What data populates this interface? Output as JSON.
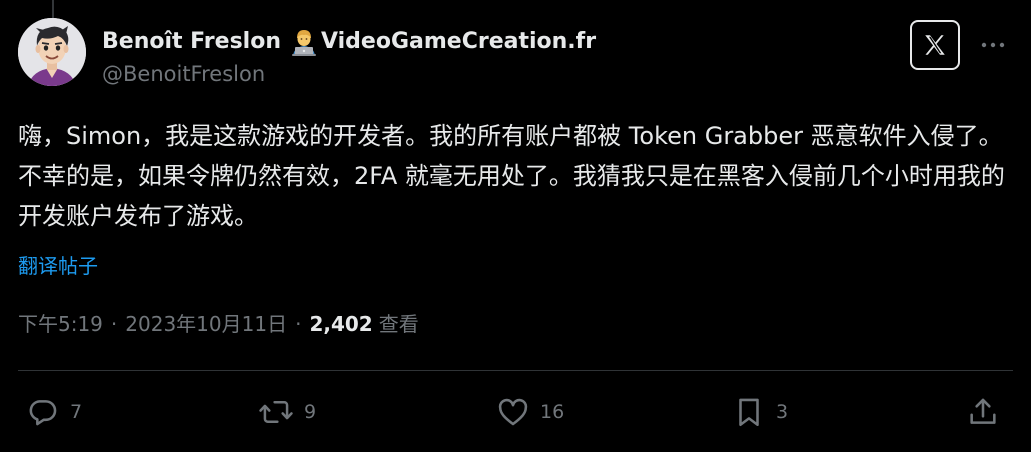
{
  "author": {
    "display_name": "Benoît Freslon",
    "name_suffix": "VideoGameCreation.fr",
    "handle": "@BenoitFreslon"
  },
  "tweet": {
    "text": "嗨，Simon，我是这款游戏的开发者。我的所有账户都被 Token Grabber 恶意软件入侵了。不幸的是，如果令牌仍然有效，2FA 就毫无用处了。我猜我只是在黑客入侵前几个小时用我的开发账户发布了游戏。",
    "translate_label": "翻译帖子"
  },
  "meta": {
    "time": "下午5:19",
    "separator": "·",
    "date": "2023年10月11日",
    "views_count": "2,402",
    "views_label": "查看"
  },
  "actions": {
    "replies": "7",
    "reposts": "9",
    "likes": "16",
    "bookmarks": "3"
  },
  "icons": {
    "emoji": "technologist-emoji",
    "logo": "x-logo-icon",
    "more": "more-icon",
    "reply": "reply-icon",
    "repost": "repost-icon",
    "like": "like-icon",
    "bookmark": "bookmark-icon",
    "share": "share-icon"
  },
  "colors": {
    "background": "#000000",
    "primary_text": "#e7e9ea",
    "secondary_text": "#71767b",
    "link": "#1d9bf0",
    "divider": "#2f3336"
  }
}
